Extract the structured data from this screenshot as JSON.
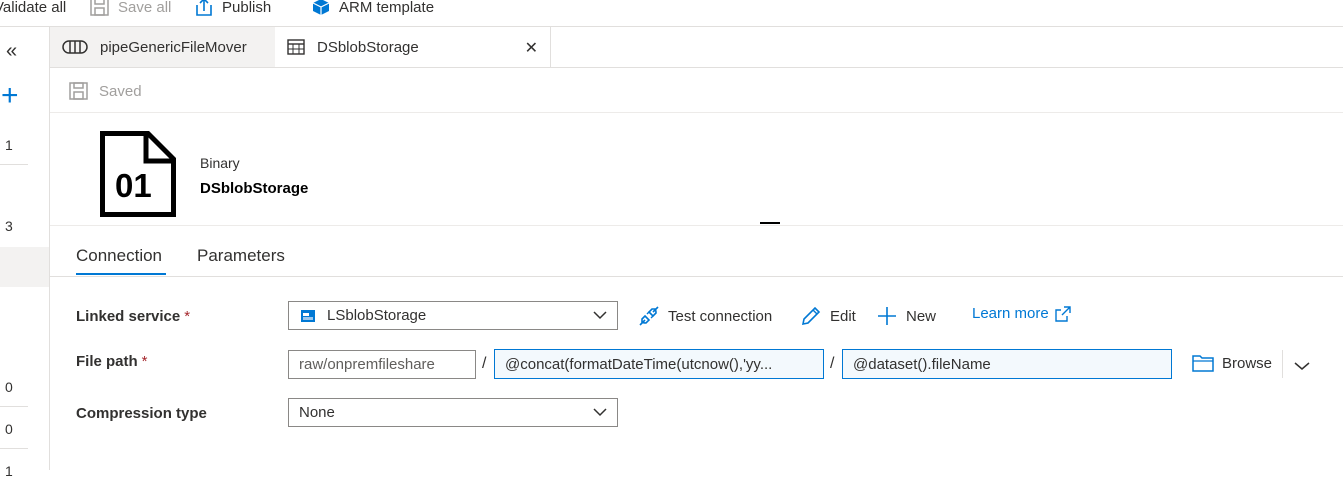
{
  "toolbar": {
    "validate_all": "Validate all",
    "save_all": "Save all",
    "publish": "Publish",
    "arm_template": "ARM template"
  },
  "left_rail": {
    "collapse_glyph": "«",
    "add_glyph": "+",
    "counts": [
      "1",
      "3",
      "0",
      "0",
      "1"
    ]
  },
  "tabs": [
    {
      "label": "pipeGenericFileMover",
      "icon": "pipeline-icon"
    },
    {
      "label": "DSblobStorage",
      "icon": "table-icon"
    }
  ],
  "status": {
    "saved": "Saved"
  },
  "dataset": {
    "icon_text": "01",
    "type": "Binary",
    "name": "DSblobStorage"
  },
  "subtabs": {
    "connection": "Connection",
    "parameters": "Parameters"
  },
  "form": {
    "linked_service_label": "Linked service",
    "required_mark": "*",
    "linked_service_value": "LSblobStorage",
    "test_connection": "Test connection",
    "edit": "Edit",
    "new": "New",
    "learn_more": "Learn more",
    "file_path_label": "File path",
    "file_path_container": "raw/onpremfileshare",
    "file_path_separator": "/",
    "file_path_directory": "@concat(formatDateTime(utcnow(),'yy...",
    "file_path_file": "@dataset().fileName",
    "browse": "Browse",
    "compression_label": "Compression type",
    "compression_value": "None"
  },
  "colors": {
    "accent": "#0078d4",
    "dynamic_bg": "#f3f9fd",
    "required": "#a4262c"
  }
}
